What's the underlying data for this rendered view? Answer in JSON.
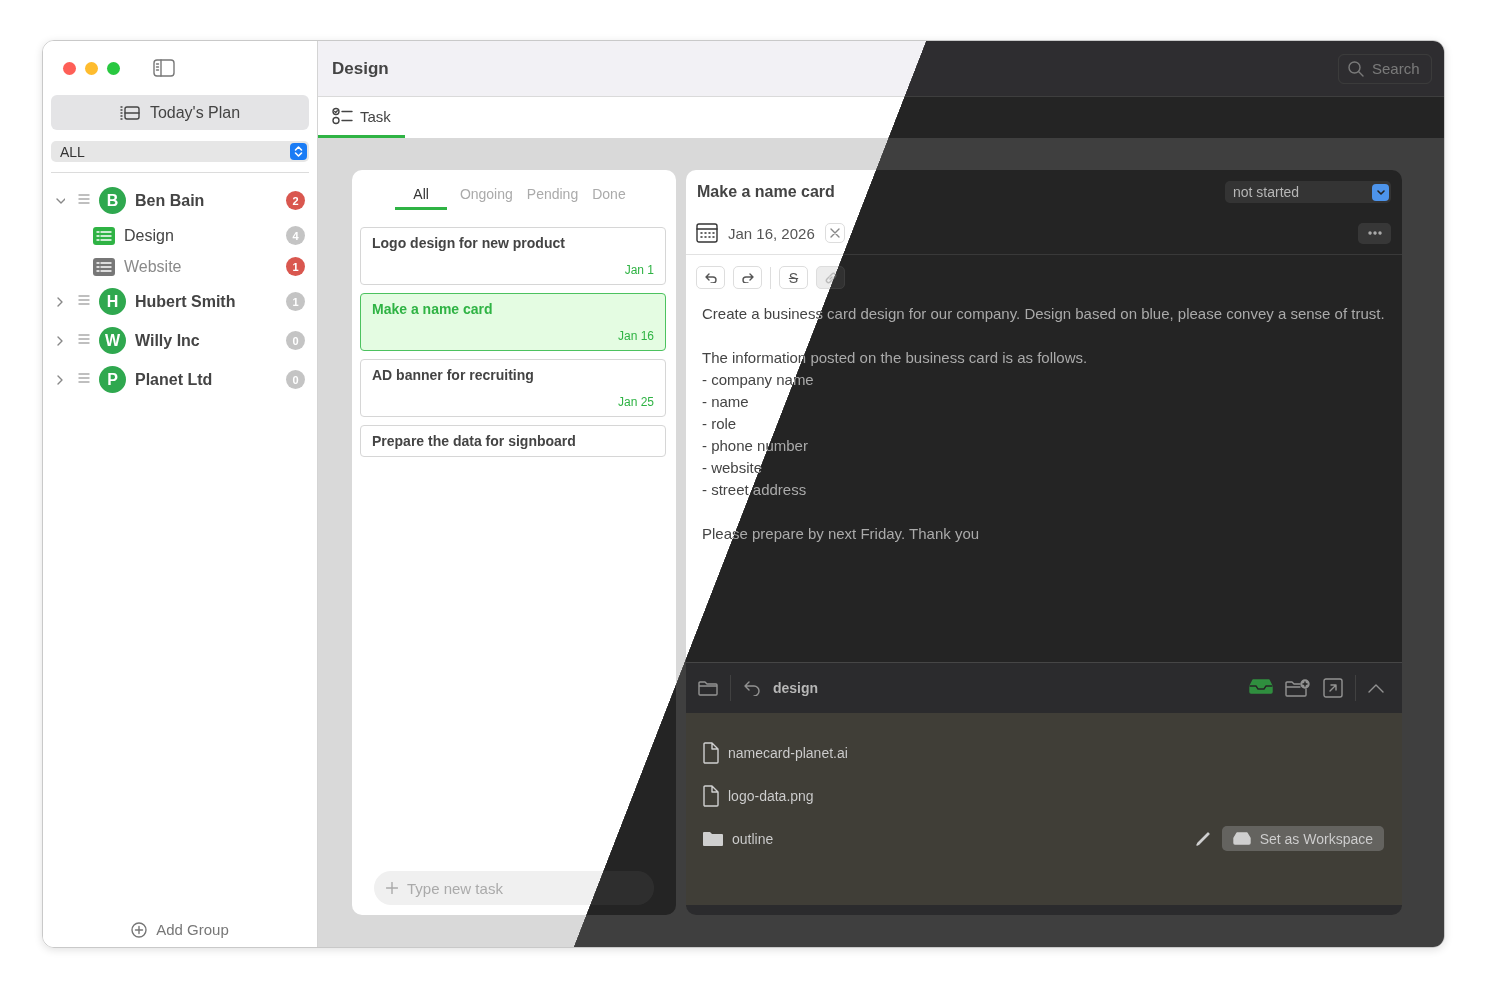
{
  "sidebar": {
    "today_button": "Today's Plan",
    "filter": "ALL",
    "groups": [
      {
        "initial": "B",
        "name": "Ben Bain",
        "count": "2",
        "color": "#d9574f",
        "expanded": true,
        "children": [
          {
            "name": "Design",
            "count": "4",
            "color": "#c4c4c4",
            "selected": true
          },
          {
            "name": "Website",
            "count": "1",
            "color": "#d9574f",
            "selected": false
          }
        ]
      },
      {
        "initial": "H",
        "name": "Hubert Smith",
        "count": "1",
        "color": "#c4c4c4",
        "expanded": false
      },
      {
        "initial": "W",
        "name": "Willy Inc",
        "count": "0",
        "color": "#c4c4c4",
        "expanded": false
      },
      {
        "initial": "P",
        "name": "Planet Ltd",
        "count": "0",
        "color": "#c4c4c4",
        "expanded": false
      }
    ],
    "add_group": "Add Group"
  },
  "header": {
    "title": "Design",
    "search": {
      "placeholder": "Search"
    }
  },
  "tabs": [
    {
      "label": "Task",
      "selected": true
    }
  ],
  "task_list": {
    "filters": [
      {
        "label": "All",
        "selected": true
      },
      {
        "label": "Ongoing",
        "selected": false
      },
      {
        "label": "Pending",
        "selected": false
      },
      {
        "label": "Done",
        "selected": false
      }
    ],
    "tasks": [
      {
        "title": "Logo design for new product",
        "date": "Jan 1",
        "selected": false
      },
      {
        "title": "Make a name card",
        "date": "Jan 16",
        "selected": true
      },
      {
        "title": "AD banner for recruiting",
        "date": "Jan 25",
        "selected": false
      },
      {
        "title": "Prepare the data for signboard",
        "selected": false
      }
    ],
    "new_task": {
      "placeholder": "Type new task"
    }
  },
  "detail": {
    "title": "Make a name card",
    "status": "not started",
    "date": "Jan 16, 2026",
    "toolbar": [
      {
        "kind": "undo",
        "disabled": false
      },
      {
        "kind": "redo",
        "disabled": false
      },
      {
        "kind": "strike",
        "label": "S",
        "disabled": false
      },
      {
        "kind": "link",
        "disabled": true
      }
    ],
    "description": [
      {
        "lines": [
          "Create a business card design for our company. Design based on blue, please convey a sense of trust."
        ]
      },
      {
        "lines": [
          "The information posted on the business card is as follows.",
          "- company name",
          "- name",
          "- role",
          "- phone number",
          "- website",
          "- street address"
        ]
      },
      {
        "lines": [
          "Please prepare by next Friday. Thank you"
        ]
      }
    ],
    "files": {
      "folder": "design",
      "items": [
        {
          "kind": "file",
          "name": "namecard-planet.ai"
        },
        {
          "kind": "file",
          "name": "logo-data.png"
        },
        {
          "kind": "folder",
          "name": "outline",
          "action": "Set as Workspace"
        }
      ]
    }
  }
}
